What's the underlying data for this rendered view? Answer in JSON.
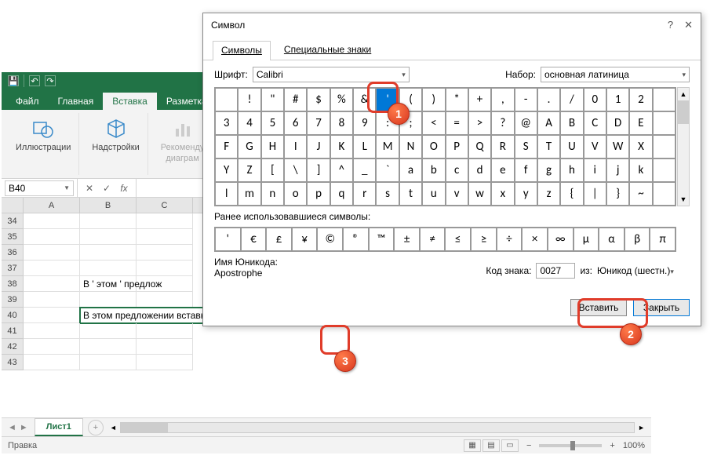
{
  "excel": {
    "tabs": {
      "file": "Файл",
      "home": "Главная",
      "insert": "Вставка",
      "layout": "Разметка стр"
    },
    "ribbon": {
      "illustrations": "Иллюстрации",
      "addins": "Надстройки",
      "rec_chart_l1": "Рекоменду",
      "rec_chart_l2": "диаграм"
    },
    "namebox": "B40",
    "formula": "",
    "cols": [
      "A",
      "B",
      "C"
    ],
    "rows": [
      "34",
      "35",
      "36",
      "37",
      "38",
      "39",
      "40",
      "41",
      "42",
      "43"
    ],
    "row38_text": "В ' этом ' предлож",
    "row40_text": "В этом предложении вставка апострофа (') выполнена через таблицу символов.",
    "sheet": "Лист1",
    "status": "Правка",
    "zoom": "100%"
  },
  "dialog": {
    "title": "Символ",
    "tab_symbols": "Символы",
    "tab_special": "Специальные знаки",
    "font_label": "Шрифт:",
    "font_value": "Calibri",
    "subset_label": "Набор:",
    "subset_value": "основная латиница",
    "grid_rows": [
      [
        " ",
        "!",
        "\"",
        "#",
        "$",
        "%",
        "&",
        "'",
        "(",
        ")",
        "*",
        "+",
        ",",
        "-",
        ".",
        "/",
        "0",
        "1",
        "2"
      ],
      [
        "3",
        "4",
        "5",
        "6",
        "7",
        "8",
        "9",
        ":",
        ";",
        "<",
        "=",
        ">",
        "?",
        "@",
        "A",
        "B",
        "C",
        "D",
        "E"
      ],
      [
        "F",
        "G",
        "H",
        "I",
        "J",
        "K",
        "L",
        "M",
        "N",
        "O",
        "P",
        "Q",
        "R",
        "S",
        "T",
        "U",
        "V",
        "W",
        "X"
      ],
      [
        "Y",
        "Z",
        "[",
        "\\",
        "]",
        "^",
        "_",
        "`",
        "a",
        "b",
        "c",
        "d",
        "e",
        "f",
        "g",
        "h",
        "i",
        "j",
        "k"
      ],
      [
        "l",
        "m",
        "n",
        "o",
        "p",
        "q",
        "r",
        "s",
        "t",
        "u",
        "v",
        "w",
        "x",
        "y",
        "z",
        "{",
        "|",
        "}",
        "~"
      ]
    ],
    "selected_index": 7,
    "recent_label": "Ранее использовавшиеся символы:",
    "recent": [
      "'",
      "€",
      "£",
      "¥",
      "©",
      "®",
      "™",
      "±",
      "≠",
      "≤",
      "≥",
      "÷",
      "×",
      "∞",
      "µ",
      "α",
      "β",
      "π"
    ],
    "unicode_name_label": "Имя Юникода:",
    "unicode_name": "Apostrophe",
    "code_label": "Код знака:",
    "code_value": "0027",
    "from_label": "из:",
    "from_value": "Юникод (шестн.)",
    "btn_insert": "Вставить",
    "btn_close": "Закрыть"
  },
  "callouts": {
    "n1": "1",
    "n2": "2",
    "n3": "3"
  }
}
